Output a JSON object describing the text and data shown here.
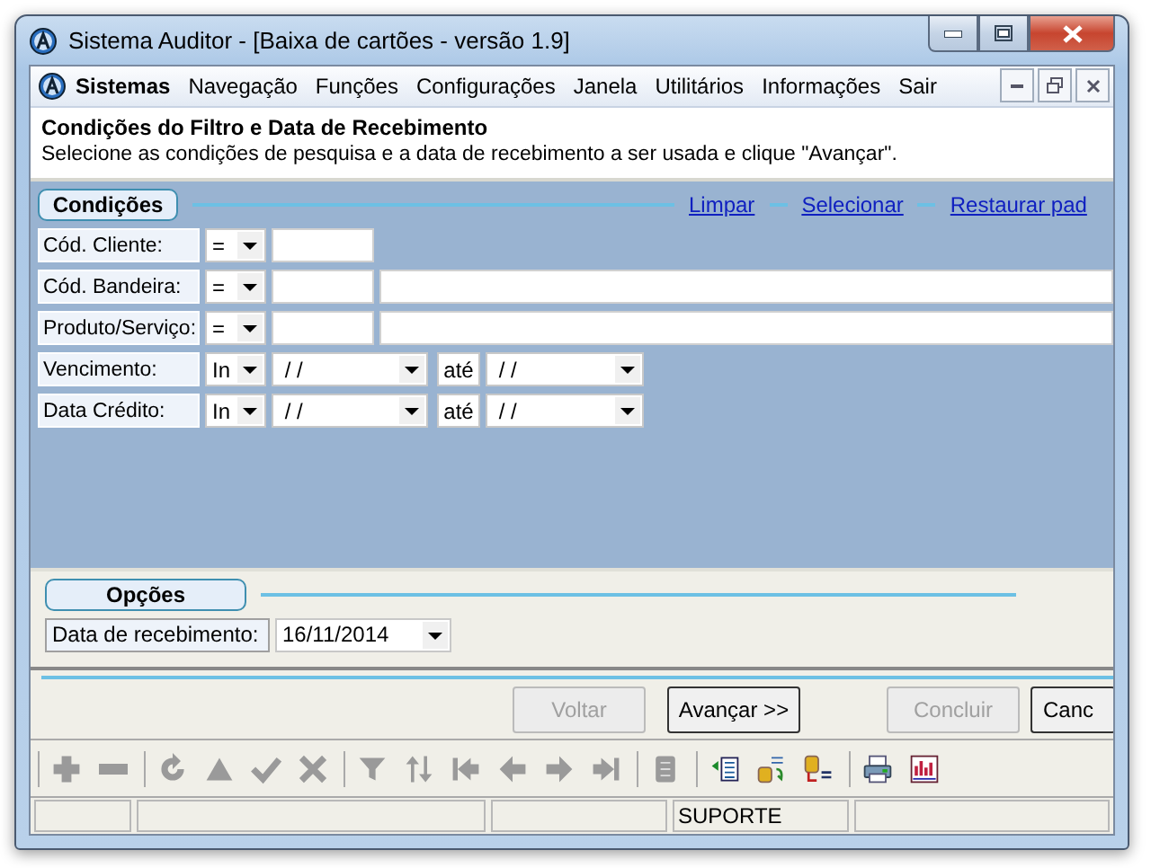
{
  "window": {
    "title": "Sistema Auditor - [Baixa de cartões - versão 1.9]"
  },
  "menu": [
    {
      "label": "Sistemas",
      "bold": true
    },
    {
      "label": "Navegação",
      "bold": false
    },
    {
      "label": "Funções",
      "bold": false
    },
    {
      "label": "Configurações",
      "bold": false
    },
    {
      "label": "Janela",
      "bold": false
    },
    {
      "label": "Utilitários",
      "bold": false
    },
    {
      "label": "Informações",
      "bold": false
    },
    {
      "label": "Sair",
      "bold": false
    }
  ],
  "header": {
    "title": "Condições do Filtro e Data de Recebimento",
    "subtitle": "Selecione as condições de pesquisa e a data de recebimento a ser usada e clique \"Avançar\"."
  },
  "conditions": {
    "title": "Condições",
    "links": [
      "Limpar",
      "Selecionar",
      "Restaurar pad"
    ],
    "rows": [
      {
        "kind": "code",
        "label": "Cód. Cliente:",
        "operator": "="
      },
      {
        "kind": "code_desc",
        "label": "Cód. Bandeira:",
        "operator": "="
      },
      {
        "kind": "code_desc",
        "label": "Produto/Serviço:",
        "operator": "="
      },
      {
        "kind": "range",
        "label": "Vencimento:",
        "operator": "In",
        "from": "/ /",
        "connector": "até",
        "to": "/ /"
      },
      {
        "kind": "range",
        "label": "Data Crédito:",
        "operator": "In",
        "from": "/ /",
        "connector": "até",
        "to": "/ /"
      }
    ]
  },
  "options": {
    "title": "Opções",
    "rows": [
      {
        "label": "Data de recebimento:",
        "value": "16/11/2014"
      }
    ]
  },
  "buttons": [
    {
      "label": "Voltar",
      "disabled": true
    },
    {
      "label": "Avançar >>",
      "disabled": false
    },
    {
      "label": "Concluir",
      "disabled": true
    },
    {
      "label": "Canc",
      "disabled": false
    }
  ],
  "toolbar": [
    [
      {
        "kind": "plus",
        "disabled": true
      },
      {
        "kind": "minus",
        "disabled": true
      }
    ],
    [
      {
        "kind": "refresh",
        "disabled": true
      },
      {
        "kind": "up",
        "disabled": true
      },
      {
        "kind": "check",
        "disabled": true
      },
      {
        "kind": "cross",
        "disabled": true
      }
    ],
    [
      {
        "kind": "filter",
        "disabled": true
      },
      {
        "kind": "sort",
        "disabled": true
      },
      {
        "kind": "first",
        "disabled": true
      },
      {
        "kind": "prev",
        "disabled": true
      },
      {
        "kind": "next",
        "disabled": true
      },
      {
        "kind": "last",
        "disabled": true
      }
    ],
    [
      {
        "kind": "notes",
        "disabled": true
      }
    ],
    [
      {
        "kind": "list",
        "disabled": false
      },
      {
        "kind": "transfer",
        "disabled": false
      },
      {
        "kind": "query",
        "disabled": false
      }
    ],
    [
      {
        "kind": "printer",
        "disabled": false
      },
      {
        "kind": "report",
        "disabled": false
      }
    ]
  ],
  "status_bar": {
    "user": "SUPORTE"
  }
}
